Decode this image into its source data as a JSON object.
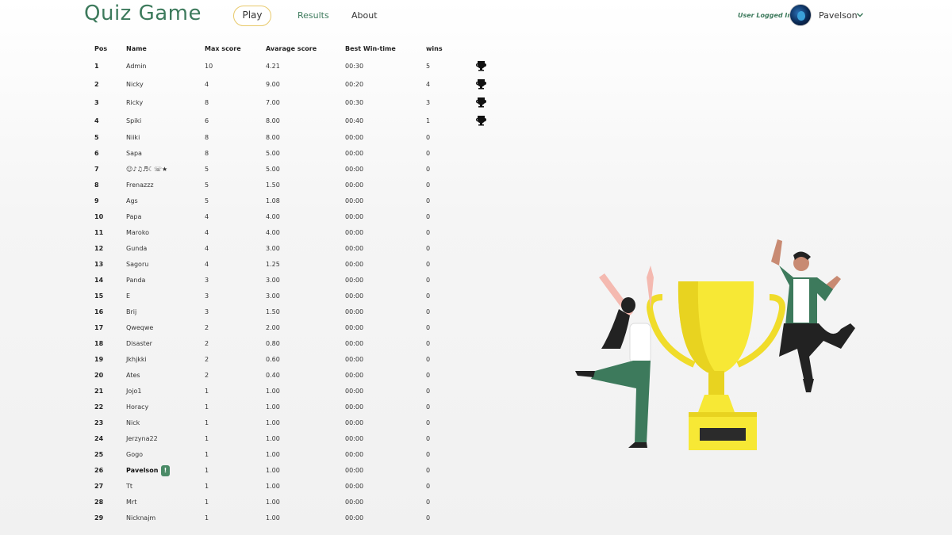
{
  "app": {
    "logo": "Quiz Game",
    "nav": {
      "play": "Play",
      "results": "Results",
      "about": "About"
    },
    "user_status": "User Logged In!",
    "username": "Pavelson",
    "avatar_icon": "avatar-image",
    "accent": "#3d7a5c",
    "play_border": "#e8c96a"
  },
  "table": {
    "headers": {
      "pos": "Pos",
      "name": "Name",
      "max": "Max score",
      "avg": "Avarage score",
      "best": "Best Win-time",
      "wins": "wins"
    },
    "current_user_badge": "!",
    "rows": [
      {
        "pos": "1",
        "name": "Admin",
        "max": "10",
        "avg": "4.21",
        "best": "00:30",
        "wins": "5",
        "trophy": true
      },
      {
        "pos": "2",
        "name": "Nicky",
        "max": "4",
        "avg": "9.00",
        "best": "00:20",
        "wins": "4",
        "trophy": true
      },
      {
        "pos": "3",
        "name": "Ricky",
        "max": "8",
        "avg": "7.00",
        "best": "00:30",
        "wins": "3",
        "trophy": true
      },
      {
        "pos": "4",
        "name": "Spiki",
        "max": "6",
        "avg": "8.00",
        "best": "00:40",
        "wins": "1",
        "trophy": true
      },
      {
        "pos": "5",
        "name": "Niiki",
        "max": "8",
        "avg": "8.00",
        "best": "00:00",
        "wins": "0"
      },
      {
        "pos": "6",
        "name": "Sapa",
        "max": "8",
        "avg": "5.00",
        "best": "00:00",
        "wins": "0"
      },
      {
        "pos": "7",
        "name": "☺♪♫♬☾☏★",
        "max": "5",
        "avg": "5.00",
        "best": "00:00",
        "wins": "0"
      },
      {
        "pos": "8",
        "name": "Frenazzz",
        "max": "5",
        "avg": "1.50",
        "best": "00:00",
        "wins": "0"
      },
      {
        "pos": "9",
        "name": "Ags",
        "max": "5",
        "avg": "1.08",
        "best": "00:00",
        "wins": "0"
      },
      {
        "pos": "10",
        "name": "Papa",
        "max": "4",
        "avg": "4.00",
        "best": "00:00",
        "wins": "0"
      },
      {
        "pos": "11",
        "name": "Maroko",
        "max": "4",
        "avg": "4.00",
        "best": "00:00",
        "wins": "0"
      },
      {
        "pos": "12",
        "name": "Gunda",
        "max": "4",
        "avg": "3.00",
        "best": "00:00",
        "wins": "0"
      },
      {
        "pos": "13",
        "name": "Sagoru",
        "max": "4",
        "avg": "1.25",
        "best": "00:00",
        "wins": "0"
      },
      {
        "pos": "14",
        "name": "Panda",
        "max": "3",
        "avg": "3.00",
        "best": "00:00",
        "wins": "0"
      },
      {
        "pos": "15",
        "name": "E",
        "max": "3",
        "avg": "3.00",
        "best": "00:00",
        "wins": "0"
      },
      {
        "pos": "16",
        "name": "Brij",
        "max": "3",
        "avg": "1.50",
        "best": "00:00",
        "wins": "0"
      },
      {
        "pos": "17",
        "name": "Qweqwe",
        "max": "2",
        "avg": "2.00",
        "best": "00:00",
        "wins": "0"
      },
      {
        "pos": "18",
        "name": "Disaster",
        "max": "2",
        "avg": "0.80",
        "best": "00:00",
        "wins": "0"
      },
      {
        "pos": "19",
        "name": "Jkhjkki",
        "max": "2",
        "avg": "0.60",
        "best": "00:00",
        "wins": "0"
      },
      {
        "pos": "20",
        "name": "Ates",
        "max": "2",
        "avg": "0.40",
        "best": "00:00",
        "wins": "0"
      },
      {
        "pos": "21",
        "name": "Jojo1",
        "max": "1",
        "avg": "1.00",
        "best": "00:00",
        "wins": "0"
      },
      {
        "pos": "22",
        "name": "Horacy",
        "max": "1",
        "avg": "1.00",
        "best": "00:00",
        "wins": "0"
      },
      {
        "pos": "23",
        "name": "Nick",
        "max": "1",
        "avg": "1.00",
        "best": "00:00",
        "wins": "0"
      },
      {
        "pos": "24",
        "name": "Jerzyna22",
        "max": "1",
        "avg": "1.00",
        "best": "00:00",
        "wins": "0"
      },
      {
        "pos": "25",
        "name": "Gogo",
        "max": "1",
        "avg": "1.00",
        "best": "00:00",
        "wins": "0"
      },
      {
        "pos": "26",
        "name": "Pavelson",
        "max": "1",
        "avg": "1.00",
        "best": "00:00",
        "wins": "0",
        "current": true
      },
      {
        "pos": "27",
        "name": "Tt",
        "max": "1",
        "avg": "1.00",
        "best": "00:00",
        "wins": "0"
      },
      {
        "pos": "28",
        "name": "Mrt",
        "max": "1",
        "avg": "1.00",
        "best": "00:00",
        "wins": "0"
      },
      {
        "pos": "29",
        "name": "Nicknajm",
        "max": "1",
        "avg": "1.00",
        "best": "00:00",
        "wins": "0"
      }
    ]
  },
  "illustration": {
    "icon": "trophy-celebration-illustration",
    "trophy_color": "#f5e43a"
  }
}
